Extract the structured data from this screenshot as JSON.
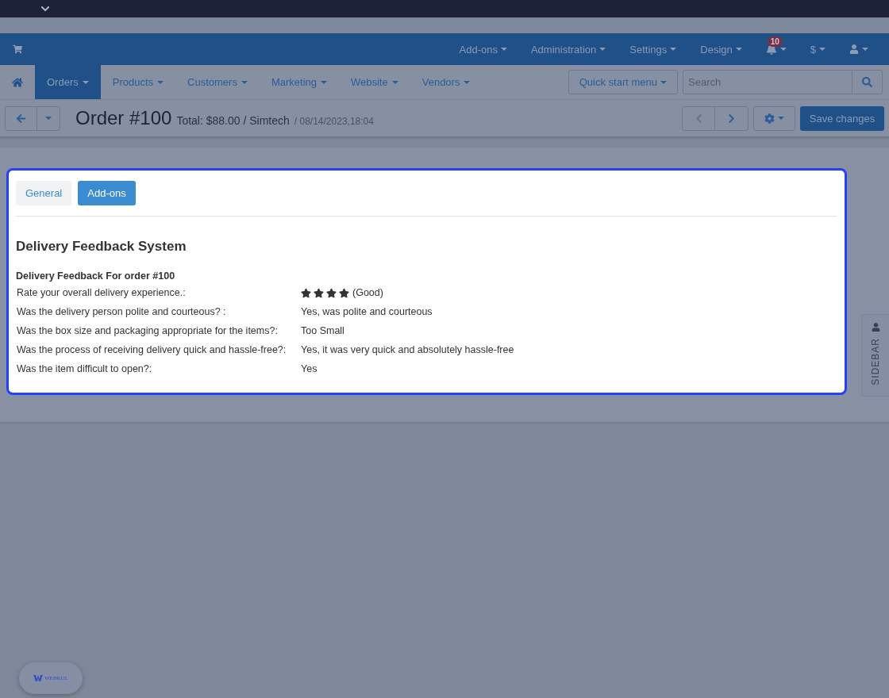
{
  "top_menu": [
    {
      "label": "Add-ons"
    },
    {
      "label": "Administration"
    },
    {
      "label": "Settings"
    },
    {
      "label": "Design"
    }
  ],
  "notifications": {
    "count": "10"
  },
  "currency": {
    "label": "$"
  },
  "main_menu": [
    {
      "label": "Orders",
      "selected": true
    },
    {
      "label": "Products",
      "selected": false
    },
    {
      "label": "Customers",
      "selected": false
    },
    {
      "label": "Marketing",
      "selected": false
    },
    {
      "label": "Website",
      "selected": false
    },
    {
      "label": "Vendors",
      "selected": false
    }
  ],
  "quick_start": {
    "label": "Quick start menu"
  },
  "search": {
    "placeholder": "Search"
  },
  "order": {
    "title": "Order #100",
    "summary": "Total: $88.00 / Simtech",
    "date": "/ 08/14/2023,18:04"
  },
  "pager": {
    "previous_disabled": true,
    "next_disabled": false
  },
  "save_button": {
    "label": "Save changes"
  },
  "tabs": [
    {
      "label": "General",
      "selected": false
    },
    {
      "label": "Add-ons",
      "selected": true
    }
  ],
  "section_title": "Delivery Feedback System",
  "form_title": "Delivery Feedback For order #100",
  "answers": [
    {
      "kind": "rating",
      "question": "Rate your overall delivery experience.:",
      "stars": 4,
      "answer": "(Good)"
    },
    {
      "kind": "text",
      "question": "Was the delivery person polite and courteous? :",
      "answer": "Yes, was polite and courteous"
    },
    {
      "kind": "text",
      "question": "Was the box size and packaging appropriate for the items?:",
      "answer": "Too Small"
    },
    {
      "kind": "text",
      "question": "Was the process of receiving delivery quick and hassle-free?:",
      "answer": "Yes, it was very quick and absolutely hassle-free"
    },
    {
      "kind": "text",
      "question": "Was the item difficult to open?:",
      "answer": "Yes"
    }
  ],
  "sidebar_tab": {
    "label": "SIDEBAR"
  },
  "floating_badge": {
    "label": "WEBKUL"
  }
}
